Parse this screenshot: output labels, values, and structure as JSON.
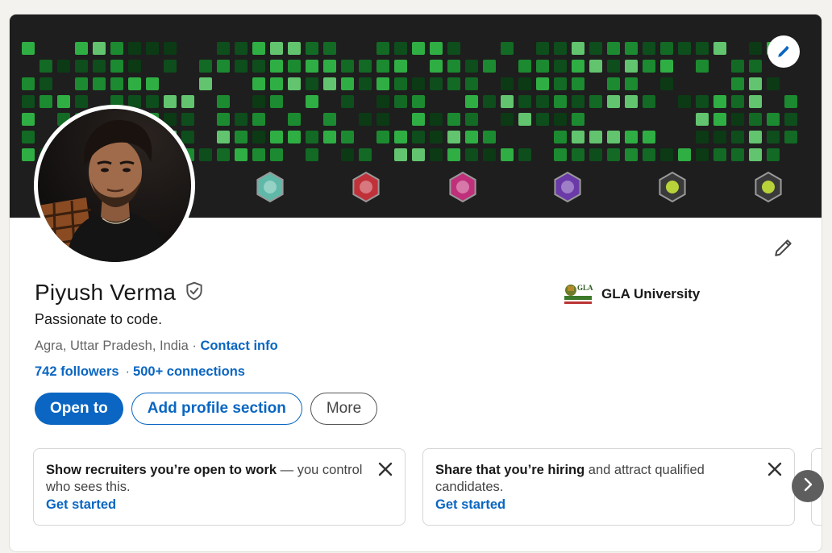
{
  "profile": {
    "name": "Piyush Verma",
    "headline": "Passionate to code.",
    "location": "Agra, Uttar Pradesh, India",
    "location_sep": " · ",
    "contact_info": "Contact info",
    "followers": "742 followers",
    "connections_sep": "·",
    "connections": "500+ connections",
    "school": "GLA University"
  },
  "actions": {
    "open_to": "Open to",
    "add_section": "Add profile section",
    "more": "More"
  },
  "promos": [
    {
      "strong": "Show recruiters you’re open to work",
      "rest": " — you control who sees this.",
      "cta": "Get started"
    },
    {
      "strong": "Share that you’re hiring",
      "rest": " and attract qualified candidates.",
      "cta": "Get started"
    }
  ],
  "icons": {
    "verified": "shield-check-icon",
    "edit": "pencil-icon",
    "close": "close-icon",
    "next": "chevron-right-icon"
  },
  "colors": {
    "brand": "#0a66c2",
    "text": "#191919",
    "muted": "#666666",
    "banner_bg": "#1e1e1e"
  }
}
